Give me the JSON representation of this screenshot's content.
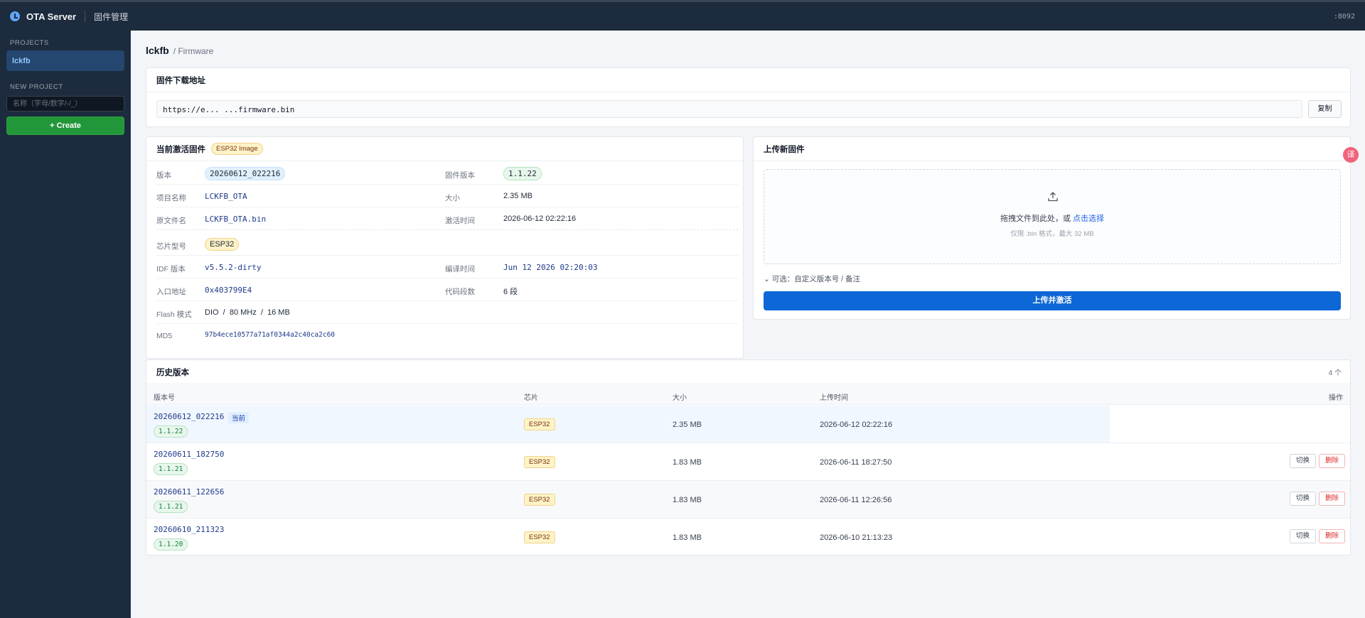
{
  "app": {
    "name": "OTA Server",
    "nav": "固件管理",
    "port": ":8092"
  },
  "sidebar": {
    "projects_label": "PROJECTS",
    "projects": [
      "lckfb"
    ],
    "new_project_label": "NEW PROJECT",
    "new_project_placeholder": "名称（字母/数字/-/_）",
    "create_label": "+ Create"
  },
  "breadcrumb": {
    "project": "lckfb",
    "section": "/ Firmware"
  },
  "download": {
    "title": "固件下载地址",
    "url": "https://e... ...firmware.bin",
    "copy_label": "复制"
  },
  "current": {
    "title": "当前激活固件",
    "image_badge": "ESP32 Image",
    "fields": {
      "version_label": "版本",
      "version": "20260612_022216",
      "fw_version_label": "固件版本",
      "fw_version": "1.1.22",
      "project_label": "项目名称",
      "project": "LCKFB_OTA",
      "size_label": "大小",
      "size": "2.35 MB",
      "filename_label": "原文件名",
      "filename": "LCKFB_OTA.bin",
      "activated_label": "激活时间",
      "activated": "2026-06-12 02:22:16",
      "chip_label": "芯片型号",
      "chip": "ESP32",
      "idf_label": "IDF 版本",
      "idf": "v5.5.2-dirty",
      "build_label": "编译时间",
      "build": "Jun 12 2026 02:20:03",
      "entry_label": "入口地址",
      "entry": "0x403799E4",
      "segments_label": "代码段数",
      "segments": "6 段",
      "flash_label": "Flash 模式",
      "flash": "DIO  /  80 MHz  /  16 MB",
      "md5_label": "MD5",
      "md5": "97b4ece10577a71af0344a2c40ca2c60"
    }
  },
  "upload": {
    "title": "上传新固件",
    "drop_text": "拖拽文件到此处，或",
    "drop_link": "点击选择",
    "hint": "仅限 .bin 格式，最大 32 MB",
    "optional": "可选：自定义版本号 / 备注",
    "button": "上传并激活",
    "translate_icon_text": "译"
  },
  "history": {
    "title": "历史版本",
    "count": "4 个",
    "columns": [
      "版本号",
      "芯片",
      "大小",
      "上传时间",
      "操作"
    ],
    "current_tag": "当前",
    "switch_label": "切换",
    "delete_label": "删除",
    "rows": [
      {
        "version": "20260612_022216",
        "semver": "1.1.22",
        "chip": "ESP32",
        "size": "2.35 MB",
        "time": "2026-06-12 02:22:16",
        "current": true
      },
      {
        "version": "20260611_182750",
        "semver": "1.1.21",
        "chip": "ESP32",
        "size": "1.83 MB",
        "time": "2026-06-11 18:27:50",
        "current": false
      },
      {
        "version": "20260611_122656",
        "semver": "1.1.21",
        "chip": "ESP32",
        "size": "1.83 MB",
        "time": "2026-06-11 12:26:56",
        "current": false
      },
      {
        "version": "20260610_211323",
        "semver": "1.1.20",
        "chip": "ESP32",
        "size": "1.83 MB",
        "time": "2026-06-10 21:13:23",
        "current": false
      }
    ]
  }
}
